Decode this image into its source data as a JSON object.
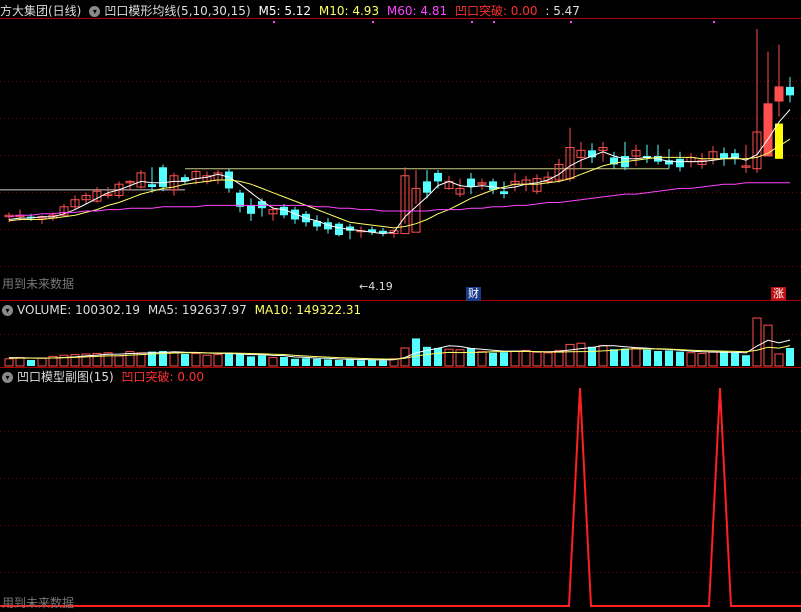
{
  "main_header": {
    "stock_name": "方大集团(日线)",
    "indicator": "凹口模形均线(5,10,30,15)",
    "m5_label": "M5: 5.12",
    "m10_label": "M10: 4.93",
    "m60_label": "M60: 4.81",
    "breakout_label": "凹口突破: 0.00",
    "price_label": ": 5.47"
  },
  "volume_header": {
    "volume_label": "VOLUME: 100302.19",
    "ma5_label": "MA5: 192637.97",
    "ma10_label": "MA10: 149322.31"
  },
  "sub_header": {
    "indicator": "凹口模型副图(15)",
    "breakout_label": "凹口突破: 0.00"
  },
  "watermark": "用到未来数据",
  "low_marker": "4.19",
  "finance_tag": "财",
  "rise_tag": "涨",
  "colors": {
    "up": "#ff5050",
    "down": "#54ffff",
    "m5": "#ffffff",
    "m10": "#ffff66",
    "m60": "#ff44ff",
    "breakout": "#ff2020",
    "grid": "#7a0000",
    "bg": "#000000"
  },
  "chart_data": [
    {
      "type": "candlestick",
      "panel": "price",
      "ylim": [
        4.05,
        5.95
      ],
      "series": {
        "open": [
          4.57,
          4.57,
          4.57,
          4.56,
          4.56,
          4.58,
          4.64,
          4.69,
          4.68,
          4.72,
          4.72,
          4.81,
          4.78,
          4.8,
          4.92,
          4.76,
          4.85,
          4.84,
          4.82,
          4.83,
          4.89,
          4.74,
          4.65,
          4.68,
          4.59,
          4.64,
          4.62,
          4.59,
          4.54,
          4.53,
          4.52,
          4.5,
          4.47,
          4.48,
          4.47,
          4.45,
          4.45,
          4.46,
          4.82,
          4.88,
          4.77,
          4.73,
          4.84,
          4.8,
          4.82,
          4.75,
          4.8,
          4.8,
          4.75,
          4.82,
          4.83,
          4.84,
          4.99,
          5.04,
          5.04,
          4.99,
          5.0,
          5.0,
          5.0,
          5.0,
          4.97,
          4.98,
          4.96,
          4.94,
          4.98,
          5.02,
          5.02,
          4.92,
          4.91,
          5.0,
          5.39,
          5.49
        ],
        "close": [
          4.58,
          4.58,
          4.56,
          4.57,
          4.58,
          4.64,
          4.69,
          4.72,
          4.75,
          4.73,
          4.8,
          4.82,
          4.88,
          4.78,
          4.78,
          4.86,
          4.82,
          4.89,
          4.86,
          4.88,
          4.77,
          4.64,
          4.59,
          4.63,
          4.62,
          4.58,
          4.55,
          4.53,
          4.5,
          4.48,
          4.44,
          4.47,
          4.47,
          4.46,
          4.45,
          4.47,
          4.86,
          4.77,
          4.74,
          4.82,
          4.82,
          4.77,
          4.78,
          4.81,
          4.76,
          4.73,
          4.82,
          4.83,
          4.84,
          4.85,
          4.94,
          5.06,
          5.04,
          4.99,
          5.06,
          4.94,
          4.92,
          5.04,
          4.99,
          4.96,
          4.94,
          4.92,
          4.99,
          4.97,
          5.03,
          4.98,
          4.98,
          4.93,
          5.17,
          5.37,
          5.49,
          5.43
        ],
        "high": [
          4.6,
          4.62,
          4.59,
          4.58,
          4.6,
          4.66,
          4.72,
          4.74,
          4.78,
          4.78,
          4.82,
          4.83,
          4.9,
          4.92,
          4.94,
          4.88,
          4.87,
          4.9,
          4.89,
          4.9,
          4.91,
          4.76,
          4.7,
          4.7,
          4.64,
          4.66,
          4.64,
          4.61,
          4.58,
          4.56,
          4.53,
          4.52,
          4.5,
          4.5,
          4.49,
          4.48,
          4.92,
          4.9,
          4.9,
          4.9,
          4.86,
          4.84,
          4.88,
          4.84,
          4.84,
          4.82,
          4.88,
          4.86,
          4.87,
          4.89,
          4.98,
          5.2,
          5.1,
          5.09,
          5.1,
          5.03,
          5.1,
          5.08,
          5.08,
          5.08,
          5.05,
          5.03,
          5.02,
          5.02,
          5.07,
          5.06,
          5.05,
          5.08,
          5.9,
          5.74,
          5.79,
          5.56
        ],
        "low": [
          4.53,
          4.54,
          4.54,
          4.52,
          4.54,
          4.57,
          4.62,
          4.66,
          4.67,
          4.7,
          4.7,
          4.76,
          4.77,
          4.74,
          4.75,
          4.72,
          4.8,
          4.8,
          4.8,
          4.8,
          4.74,
          4.6,
          4.54,
          4.57,
          4.54,
          4.56,
          4.52,
          4.5,
          4.47,
          4.45,
          4.43,
          4.41,
          4.42,
          4.44,
          4.43,
          4.42,
          4.52,
          4.66,
          4.7,
          4.77,
          4.76,
          4.71,
          4.73,
          4.76,
          4.73,
          4.7,
          4.75,
          4.75,
          4.73,
          4.8,
          4.81,
          4.82,
          4.91,
          4.95,
          4.96,
          4.91,
          4.9,
          4.93,
          4.95,
          4.94,
          4.91,
          4.89,
          4.92,
          4.91,
          4.94,
          4.93,
          4.94,
          4.88,
          4.88,
          5.0,
          5.28,
          5.38
        ]
      },
      "lines": [
        {
          "name": "M5",
          "values": [
            4.55,
            4.56,
            4.56,
            4.57,
            4.57,
            4.59,
            4.62,
            4.66,
            4.7,
            4.74,
            4.76,
            4.79,
            4.82,
            4.81,
            4.81,
            4.82,
            4.82,
            4.84,
            4.85,
            4.87,
            4.85,
            4.8,
            4.74,
            4.68,
            4.63,
            4.62,
            4.59,
            4.56,
            4.54,
            4.51,
            4.49,
            4.48,
            4.47,
            4.46,
            4.45,
            4.46,
            4.57,
            4.64,
            4.71,
            4.79,
            4.82,
            4.79,
            4.78,
            4.79,
            4.78,
            4.77,
            4.78,
            4.8,
            4.81,
            4.83,
            4.87,
            4.93,
            4.97,
            5.0,
            5.03,
            5.0,
            4.98,
            4.98,
            4.99,
            4.98,
            4.96,
            4.96,
            4.96,
            4.96,
            4.97,
            4.98,
            4.99,
            4.97,
            5.01,
            5.12,
            5.24,
            5.33
          ]
        },
        {
          "name": "M10",
          "values": [
            4.54,
            4.55,
            4.55,
            4.55,
            4.56,
            4.57,
            4.58,
            4.6,
            4.62,
            4.65,
            4.67,
            4.7,
            4.73,
            4.75,
            4.77,
            4.78,
            4.8,
            4.81,
            4.82,
            4.83,
            4.83,
            4.82,
            4.8,
            4.77,
            4.74,
            4.71,
            4.68,
            4.65,
            4.62,
            4.59,
            4.56,
            4.53,
            4.52,
            4.51,
            4.5,
            4.49,
            4.5,
            4.52,
            4.55,
            4.59,
            4.62,
            4.66,
            4.7,
            4.73,
            4.76,
            4.78,
            4.8,
            4.8,
            4.8,
            4.81,
            4.82,
            4.84,
            4.87,
            4.9,
            4.93,
            4.95,
            4.96,
            4.97,
            4.98,
            4.99,
            4.99,
            4.99,
            4.99,
            4.98,
            4.98,
            4.98,
            4.98,
            4.98,
            4.99,
            5.02,
            5.07,
            5.12
          ]
        },
        {
          "name": "M60",
          "values": [
            4.57,
            4.58,
            4.58,
            4.59,
            4.59,
            4.6,
            4.6,
            4.61,
            4.61,
            4.62,
            4.62,
            4.63,
            4.63,
            4.63,
            4.64,
            4.64,
            4.64,
            4.64,
            4.65,
            4.65,
            4.65,
            4.65,
            4.65,
            4.65,
            4.65,
            4.65,
            4.65,
            4.65,
            4.64,
            4.64,
            4.63,
            4.63,
            4.62,
            4.62,
            4.61,
            4.61,
            4.61,
            4.61,
            4.61,
            4.62,
            4.62,
            4.62,
            4.63,
            4.63,
            4.64,
            4.64,
            4.65,
            4.65,
            4.66,
            4.67,
            4.67,
            4.68,
            4.69,
            4.7,
            4.71,
            4.72,
            4.73,
            4.73,
            4.74,
            4.75,
            4.76,
            4.77,
            4.77,
            4.78,
            4.79,
            4.8,
            4.8,
            4.81,
            4.81,
            4.81,
            4.81,
            4.81
          ]
        }
      ],
      "reference_lines": [
        4.91,
        4.76
      ]
    },
    {
      "type": "bar",
      "panel": "volume",
      "ylim": [
        0,
        400000
      ],
      "values": [
        60000,
        70000,
        50000,
        65000,
        80000,
        90000,
        95000,
        100000,
        105000,
        110000,
        85000,
        120000,
        110000,
        120000,
        125000,
        115000,
        100000,
        105000,
        90000,
        95000,
        110000,
        100000,
        80000,
        90000,
        70000,
        75000,
        60000,
        65000,
        60000,
        55000,
        50000,
        55000,
        48000,
        50000,
        45000,
        60000,
        150000,
        230000,
        160000,
        150000,
        140000,
        135000,
        150000,
        120000,
        110000,
        115000,
        125000,
        130000,
        115000,
        110000,
        130000,
        180000,
        190000,
        160000,
        170000,
        140000,
        145000,
        150000,
        135000,
        125000,
        130000,
        120000,
        110000,
        105000,
        115000,
        120000,
        110000,
        90000,
        400000,
        340000,
        100302.19,
        150000
      ],
      "up": [
        true,
        true,
        false,
        true,
        true,
        true,
        true,
        true,
        true,
        true,
        true,
        true,
        true,
        false,
        false,
        true,
        false,
        true,
        true,
        true,
        false,
        false,
        false,
        false,
        true,
        false,
        false,
        false,
        false,
        false,
        false,
        false,
        false,
        false,
        false,
        true,
        true,
        false,
        false,
        false,
        true,
        true,
        false,
        true,
        false,
        false,
        true,
        true,
        true,
        true,
        true,
        true,
        true,
        false,
        true,
        false,
        false,
        true,
        false,
        false,
        false,
        false,
        true,
        true,
        true,
        false,
        false,
        false,
        true,
        true,
        true,
        false
      ],
      "lines": [
        {
          "name": "MA5",
          "values": [
            70000,
            68000,
            67000,
            66000,
            67000,
            71000,
            76000,
            84000,
            91000,
            98000,
            99000,
            104000,
            106000,
            110000,
            112000,
            118000,
            114000,
            113000,
            108000,
            105000,
            104000,
            100000,
            95000,
            95000,
            88000,
            87000,
            75000,
            72000,
            66000,
            65000,
            58000,
            57000,
            54000,
            52000,
            50000,
            52000,
            71000,
            109000,
            130000,
            148000,
            168000,
            163000,
            147000,
            139000,
            131000,
            124000,
            124000,
            124000,
            119000,
            119000,
            122000,
            133000,
            145000,
            154000,
            170000,
            168000,
            161000,
            153000,
            149000,
            141000,
            138000,
            132000,
            124000,
            118000,
            117000,
            115000,
            113000,
            109000,
            167000,
            214000,
            192637.97,
            216000
          ]
        },
        {
          "name": "MA10",
          "values": [
            65000,
            66000,
            66000,
            66000,
            67000,
            69000,
            72000,
            76000,
            80000,
            84000,
            86000,
            91000,
            95000,
            100000,
            104000,
            108000,
            109000,
            110000,
            109000,
            108000,
            108000,
            107000,
            104000,
            102000,
            98000,
            96000,
            88000,
            83000,
            78000,
            74000,
            70000,
            67000,
            63000,
            60000,
            58000,
            57000,
            64000,
            83000,
            96000,
            106000,
            113000,
            112000,
            113000,
            115000,
            119000,
            120000,
            121000,
            121000,
            120000,
            117000,
            116000,
            118000,
            120000,
            121000,
            126000,
            130000,
            140000,
            143000,
            141000,
            144000,
            141000,
            137000,
            132000,
            128000,
            126000,
            124000,
            122000,
            119000,
            132000,
            157000,
            149322.31,
            170000
          ]
        }
      ]
    },
    {
      "type": "line",
      "panel": "sub",
      "ylim": [
        0,
        1
      ],
      "values": [
        0,
        0,
        0,
        0,
        0,
        0,
        0,
        0,
        0,
        0,
        0,
        0,
        0,
        0,
        0,
        0,
        0,
        0,
        0,
        0,
        0,
        0,
        0,
        0,
        0,
        0,
        0,
        0,
        0,
        0,
        0,
        0,
        0,
        0,
        0,
        0,
        0,
        0,
        0,
        0,
        0,
        0,
        0,
        0,
        0,
        0,
        0,
        0,
        0,
        0,
        0,
        1,
        0,
        0,
        0,
        0,
        0,
        0,
        0,
        0,
        0,
        0,
        0,
        0,
        1,
        0,
        0,
        0,
        0,
        0,
        0,
        0
      ]
    }
  ]
}
